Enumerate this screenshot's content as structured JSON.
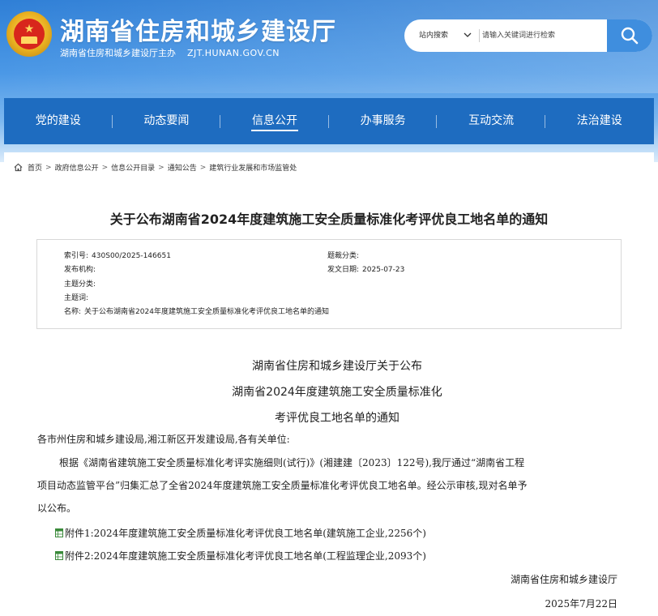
{
  "header": {
    "title": "湖南省住房和城乡建设厅",
    "subtitle": "湖南省住房和城乡建设厅主办",
    "domain": "ZJT.HUNAN.GOV.CN",
    "colors": {
      "header_top": "#2f7fd6",
      "nav": "#1e6cc0",
      "search_button": "#3f8ede"
    }
  },
  "search": {
    "scope": "站内搜索",
    "placeholder": "请输入关键词进行检索",
    "icon": "search-icon"
  },
  "nav": {
    "items": [
      {
        "label": "党的建设",
        "active": false
      },
      {
        "label": "动态要闻",
        "active": false
      },
      {
        "label": "信息公开",
        "active": true
      },
      {
        "label": "办事服务",
        "active": false
      },
      {
        "label": "互动交流",
        "active": false
      },
      {
        "label": "法治建设",
        "active": false
      }
    ]
  },
  "breadcrumb": {
    "items": [
      "首页",
      "政府信息公开",
      "信息公开目录",
      "通知公告",
      "建筑行业发展和市场监管处"
    ],
    "separator": ">"
  },
  "article": {
    "title": "关于公布湖南省2024年度建筑施工安全质量标准化考评优良工地名单的通知",
    "meta": {
      "index_label": "索引号:",
      "index_value": "430S00/2025-146651",
      "category_label": "题裁分类:",
      "category_value": "",
      "publisher_label": "发布机构:",
      "publisher_value": "",
      "date_label": "发文日期:",
      "date_value": "2025-07-23",
      "topic_label": "主题分类:",
      "topic_value": "",
      "keyword_label": "主题词:",
      "keyword_value": "",
      "name_label": "名称:",
      "name_value": "关于公布湖南省2024年度建筑施工安全质量标准化考评优良工地名单的通知"
    },
    "doc_heading": [
      "湖南省住房和城乡建设厅关于公布",
      "湖南省2024年度建筑施工安全质量标准化",
      "考评优良工地名单的通知"
    ],
    "salutation": "各市州住房和城乡建设局,湘江新区开发建设局,各有关单位:",
    "body_lines": [
      "根据《湖南省建筑施工安全质量标准化考评实施细则(试行)》(湘建建〔2023〕122号),我厅通过“湖南省工程",
      "项目动态监管平台”归集汇总了全省2024年度建筑施工安全质量标准化考评优良工地名单。经公示审核,现对名单予",
      "以公布。"
    ],
    "attachments": [
      "附件1:2024年度建筑施工安全质量标准化考评优良工地名单(建筑施工企业,2256个)",
      "附件2:2024年度建筑施工安全质量标准化考评优良工地名单(工程监理企业,2093个)"
    ],
    "signature": "湖南省住房和城乡建设厅",
    "sign_date": "2025年7月22日"
  }
}
